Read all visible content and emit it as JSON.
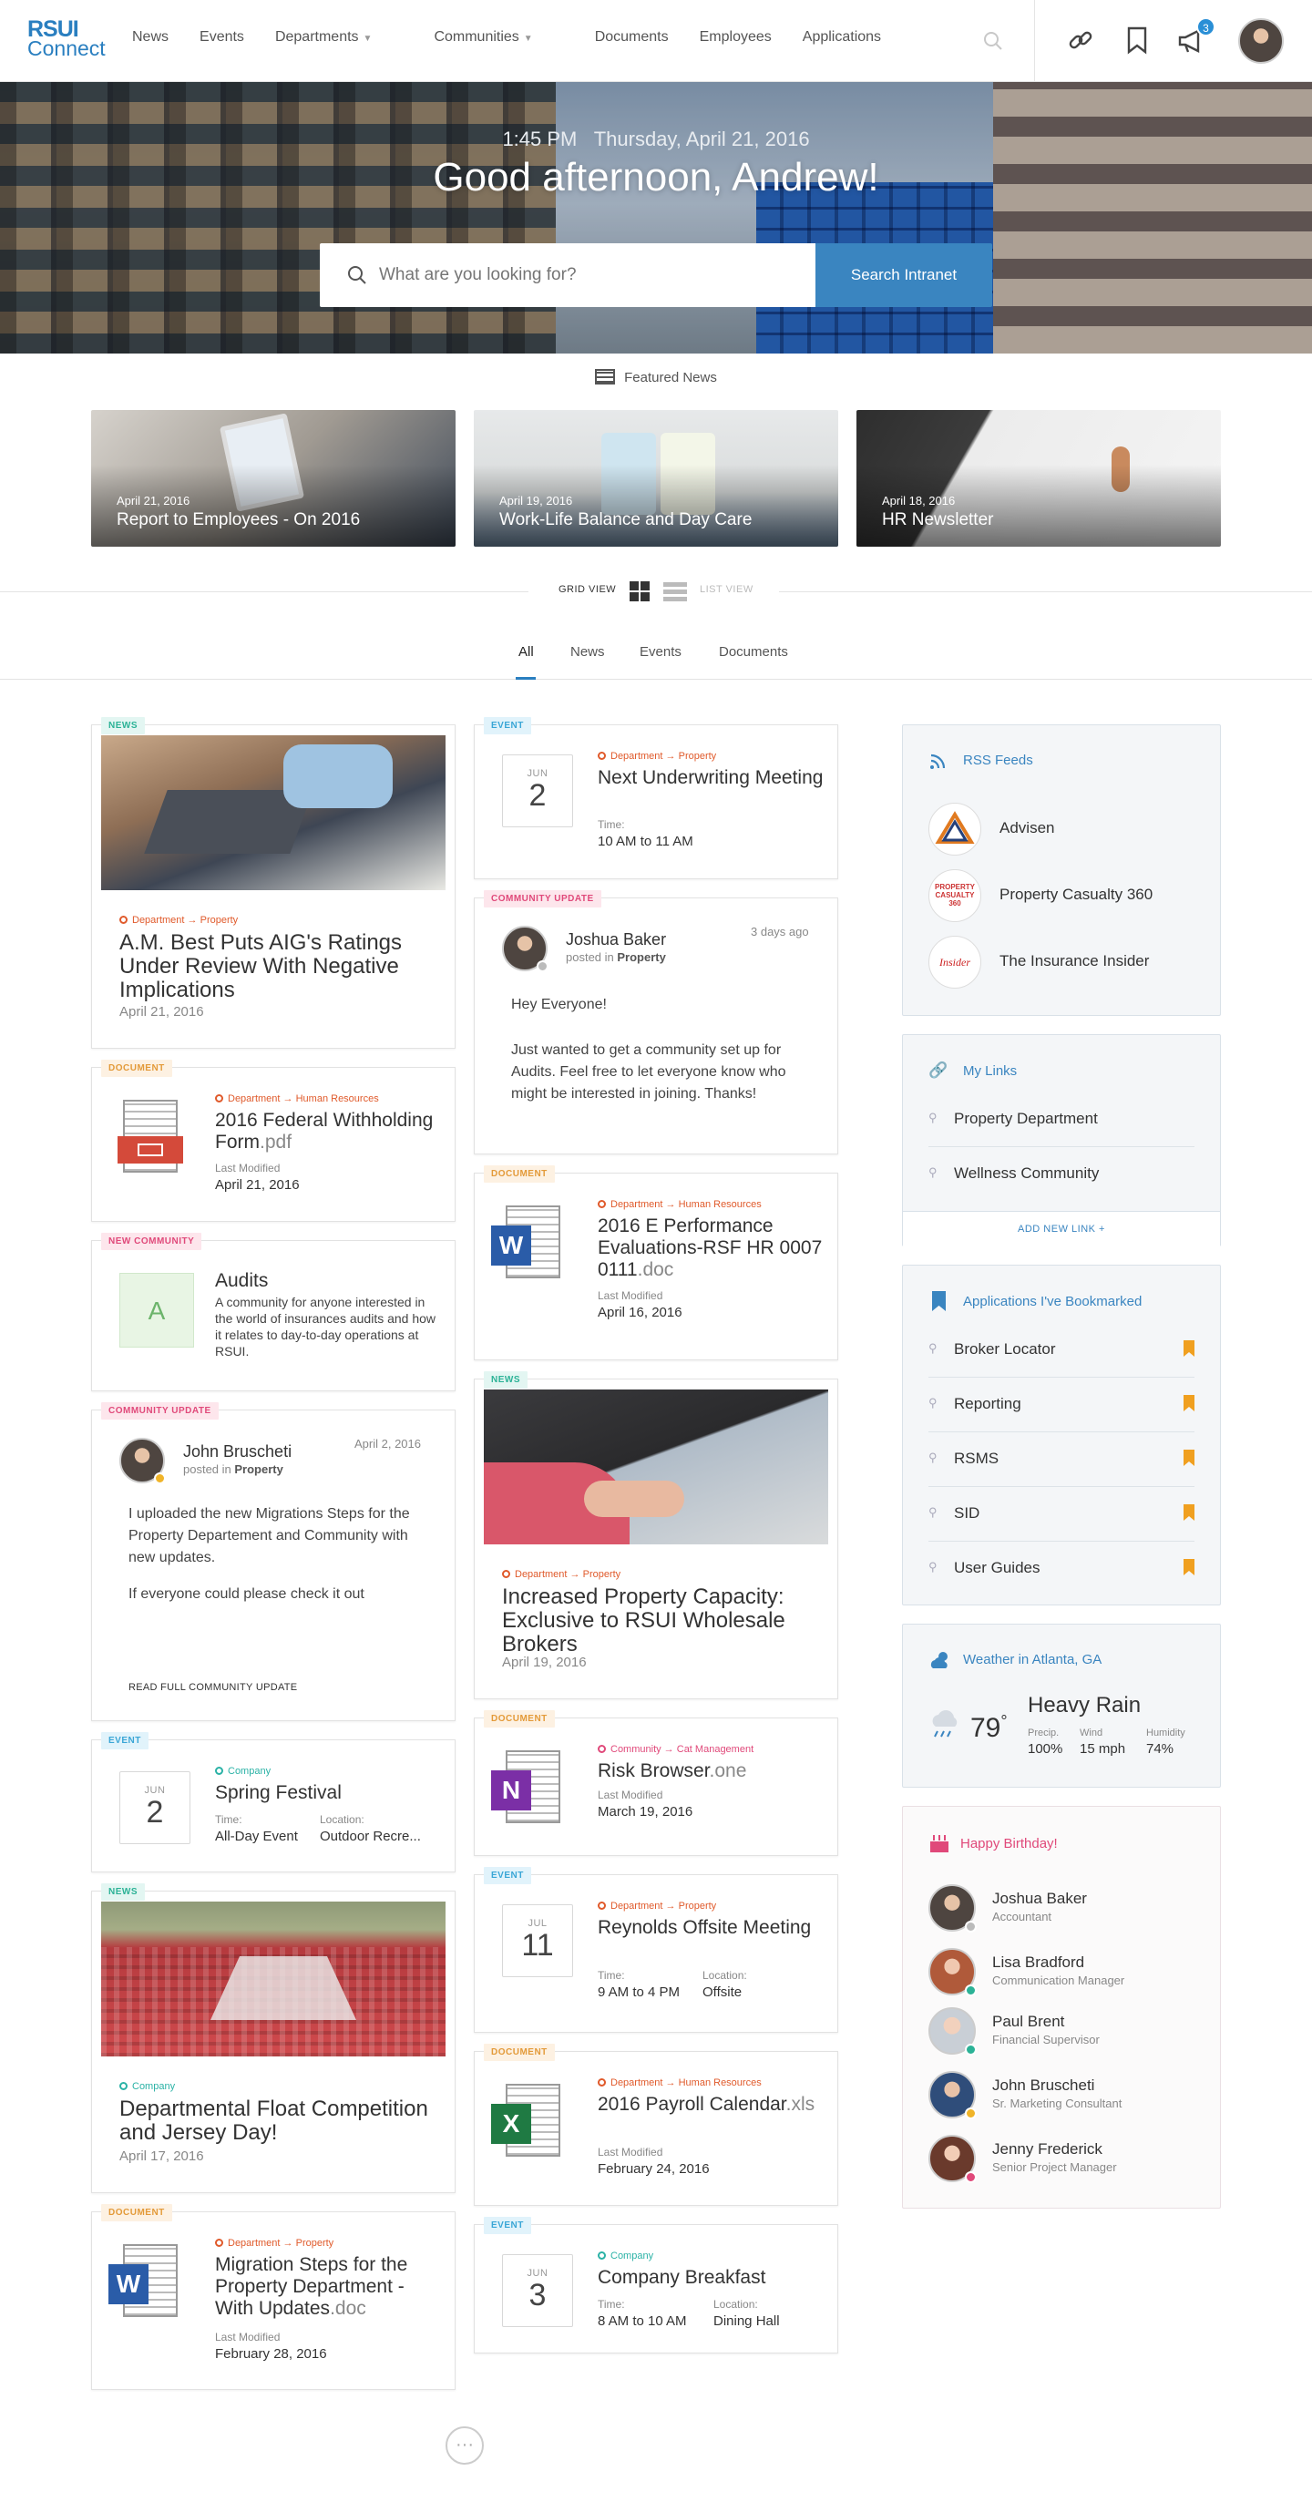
{
  "nav": {
    "logo_line1": "RSUI",
    "logo_line2": "Connect",
    "links": [
      "News",
      "Events",
      "Departments",
      "Communities",
      "Documents",
      "Employees",
      "Applications"
    ],
    "notif_count": "3"
  },
  "hero": {
    "time": "1:45 PM",
    "date": "Thursday, April 21, 2016",
    "greeting": "Good afternoon, Andrew!",
    "search_placeholder": "What are you looking for?",
    "search_button": "Search Intranet"
  },
  "featured": {
    "title": "Featured News",
    "items": [
      {
        "date": "April 21, 2016",
        "title": "Report to Employees - On 2016"
      },
      {
        "date": "April 19, 2016",
        "title": "Work-Life Balance and Day Care"
      },
      {
        "date": "April 18, 2016",
        "title": "HR Newsletter"
      }
    ]
  },
  "view": {
    "grid": "GRID VIEW",
    "list": "LIST VIEW"
  },
  "tabs": [
    "All",
    "News",
    "Events",
    "Documents"
  ],
  "col1": {
    "c1": {
      "tag": "NEWS",
      "crumb1": "Department",
      "crumb2": "Property",
      "title": "A.M. Best Puts AIG's Ratings Under Review With Negative Implications",
      "date": "April 21, 2016"
    },
    "c2": {
      "tag": "DOCUMENT",
      "crumb1": "Department",
      "crumb2": "Human Resources",
      "title": "2016 Federal Withholding Form",
      "ext": ".pdf",
      "lm": "Last Modified",
      "date": "April 21, 2016"
    },
    "c3": {
      "tag": "NEW COMMUNITY",
      "letter": "A",
      "title": "Audits",
      "desc": "A community for anyone interested in the world of insurances audits and how it relates to day-to-day operations at RSUI."
    },
    "c4": {
      "tag": "COMMUNITY UPDATE",
      "name": "John Bruscheti",
      "posted": "posted in",
      "place": "Property",
      "date": "April 2, 2016",
      "p1": "I uploaded the new Migrations Steps for the Property Departement and Community with new updates.",
      "p2": "If everyone could please check it out",
      "more": "READ FULL COMMUNITY UPDATE"
    },
    "c5": {
      "tag": "EVENT",
      "month": "JUN",
      "day": "2",
      "crumb": "Company",
      "title": "Spring Festival",
      "time_lbl": "Time:",
      "time": "All-Day Event",
      "loc_lbl": "Location:",
      "loc": "Outdoor Recre..."
    },
    "c6": {
      "tag": "NEWS",
      "crumb": "Company",
      "title": "Departmental Float Competition and Jersey Day!",
      "date": "April 17, 2016"
    },
    "c7": {
      "tag": "DOCUMENT",
      "crumb1": "Department",
      "crumb2": "Property",
      "title": "Migration Steps for the Property Department - With Updates",
      "ext": ".doc",
      "lm": "Last Modified",
      "date": "February 28, 2016"
    }
  },
  "col2": {
    "c1": {
      "tag": "EVENT",
      "month": "JUN",
      "day": "2",
      "crumb1": "Department",
      "crumb2": "Property",
      "title": "Next Underwriting Meeting",
      "time_lbl": "Time:",
      "time": "10 AM to 11 AM"
    },
    "c2": {
      "tag": "COMMUNITY UPDATE",
      "name": "Joshua Baker",
      "posted": "posted in",
      "place": "Property",
      "ago": "3 days ago",
      "p1": "Hey Everyone!",
      "p2": "Just wanted to get a community set up for Audits. Feel free to let everyone know who might be interested in joining. Thanks!"
    },
    "c3": {
      "tag": "DOCUMENT",
      "crumb1": "Department",
      "crumb2": "Human Resources",
      "title": "2016 E Performance Evaluations-RSF HR 0007 0111",
      "ext": ".doc",
      "lm": "Last Modified",
      "date": "April 16, 2016"
    },
    "c4": {
      "tag": "NEWS",
      "crumb1": "Department",
      "crumb2": "Property",
      "title": "Increased Property Capacity: Exclusive to RSUI Wholesale Brokers",
      "date": "April 19, 2016"
    },
    "c5": {
      "tag": "DOCUMENT",
      "crumb1": "Community",
      "crumb2": "Cat Management",
      "title": "Risk Browser",
      "ext": ".one",
      "lm": "Last Modified",
      "date": "March 19, 2016"
    },
    "c6": {
      "tag": "EVENT",
      "month": "JUL",
      "day": "11",
      "crumb1": "Department",
      "crumb2": "Property",
      "title": "Reynolds Offsite Meeting",
      "time_lbl": "Time:",
      "time": "9 AM to 4 PM",
      "loc_lbl": "Location:",
      "loc": "Offsite"
    },
    "c7": {
      "tag": "DOCUMENT",
      "crumb1": "Department",
      "crumb2": "Human Resources",
      "title": "2016 Payroll Calendar",
      "ext": ".xls",
      "lm": "Last Modified",
      "date": "February 24, 2016"
    },
    "c8": {
      "tag": "EVENT",
      "month": "JUN",
      "day": "3",
      "crumb": "Company",
      "title": "Company Breakfast",
      "time_lbl": "Time:",
      "time": "8 AM to 10 AM",
      "loc_lbl": "Location:",
      "loc": "Dining Hall"
    }
  },
  "side": {
    "rss": {
      "title": "RSS Feeds",
      "items": [
        "Advisen",
        "Property Casualty 360",
        "The Insurance Insider"
      ],
      "logo2_text": "PROPERTY CASUALTY 360",
      "logo3_text": "Insider"
    },
    "links": {
      "title": "My Links",
      "items": [
        "Property Department",
        "Wellness Community"
      ],
      "add": "ADD NEW LINK +"
    },
    "apps": {
      "title": "Applications I've Bookmarked",
      "items": [
        "Broker Locator",
        "Reporting",
        "RSMS",
        "SID",
        "User Guides"
      ]
    },
    "weather": {
      "title": "Weather in Atlanta, GA",
      "temp": "79",
      "deg": "°",
      "cond": "Heavy Rain",
      "precip_lbl": "Precip.",
      "precip": "100%",
      "wind_lbl": "Wind",
      "wind": "15 mph",
      "hum_lbl": "Humidity",
      "hum": "74%"
    },
    "bday": {
      "title": "Happy Birthday!",
      "people": [
        {
          "name": "Joshua Baker",
          "role": "Accountant"
        },
        {
          "name": "Lisa Bradford",
          "role": "Communication Manager"
        },
        {
          "name": "Paul Brent",
          "role": "Financial Supervisor"
        },
        {
          "name": "John Bruscheti",
          "role": "Sr. Marketing Consultant"
        },
        {
          "name": "Jenny Frederick",
          "role": "Senior Project Manager"
        }
      ]
    }
  },
  "colors": {
    "brand": "#2a7fc0",
    "accent_orange": "#e05a2b",
    "teal": "#2bb296",
    "pink": "#e0497a",
    "bookmark": "#f0a020"
  },
  "more_glyph": "···"
}
